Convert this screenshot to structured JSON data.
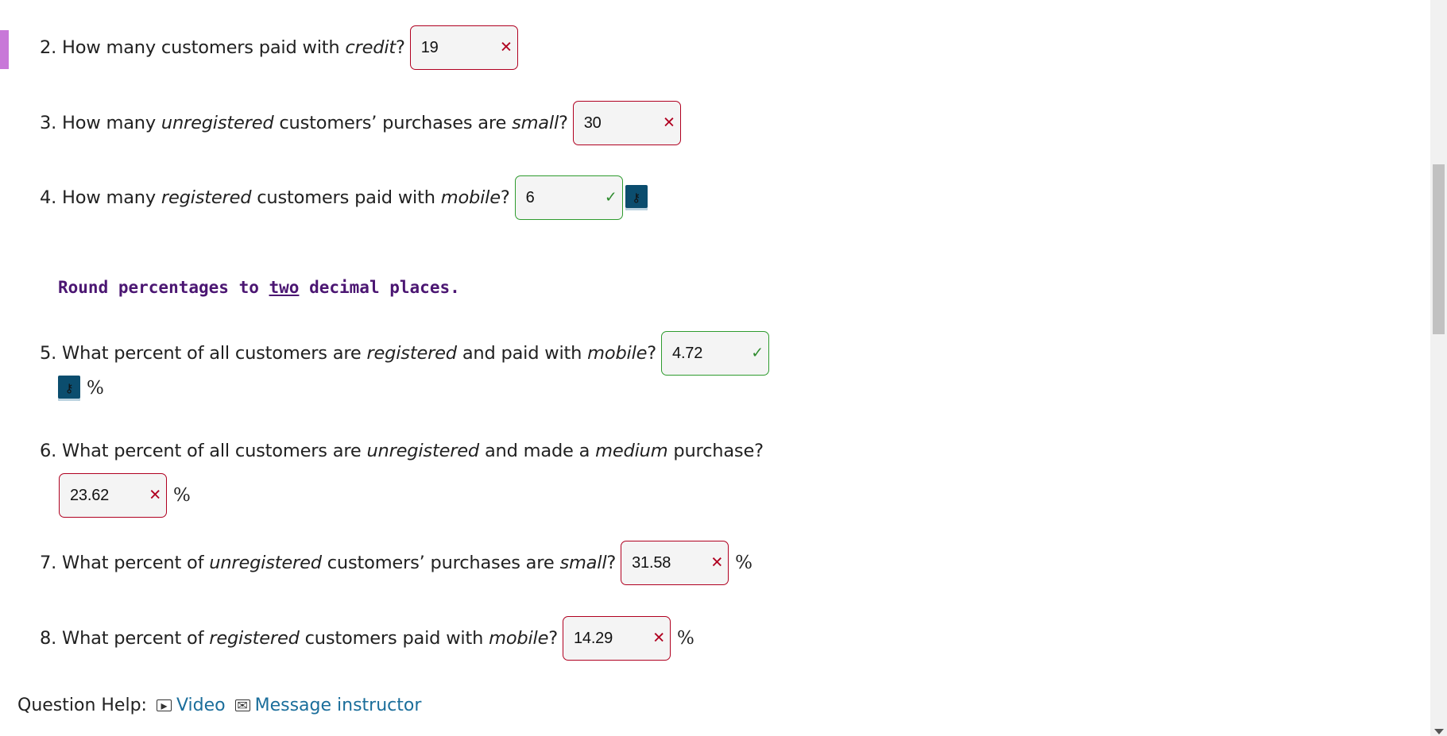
{
  "questions": [
    {
      "num": "2.",
      "parts": [
        {
          "t": "How many customers paid with "
        },
        {
          "t": "credit",
          "i": true
        },
        {
          "t": "?"
        }
      ],
      "answer": "19",
      "status": "wrong",
      "key": false,
      "pct": ""
    },
    {
      "num": "3.",
      "parts": [
        {
          "t": "How many "
        },
        {
          "t": "unregistered",
          "i": true
        },
        {
          "t": " customers’ purchases are "
        },
        {
          "t": "small",
          "i": true
        },
        {
          "t": "?"
        }
      ],
      "answer": "30",
      "status": "wrong",
      "key": false,
      "pct": ""
    },
    {
      "num": "4.",
      "parts": [
        {
          "t": "How many "
        },
        {
          "t": "registered",
          "i": true
        },
        {
          "t": " customers paid with "
        },
        {
          "t": "mobile",
          "i": true
        },
        {
          "t": "?"
        }
      ],
      "answer": "6",
      "status": "right",
      "key": true,
      "pct": ""
    },
    {
      "num": "5.",
      "parts": [
        {
          "t": "What percent of all customers are "
        },
        {
          "t": "registered",
          "i": true
        },
        {
          "t": " and paid with "
        },
        {
          "t": "mobile",
          "i": true
        },
        {
          "t": "?"
        }
      ],
      "answer": "4.72",
      "status": "right",
      "key": true,
      "pct": "%"
    },
    {
      "num": "6.",
      "parts": [
        {
          "t": "What percent of all customers are "
        },
        {
          "t": "unregistered",
          "i": true
        },
        {
          "t": " and made a "
        },
        {
          "t": "medium",
          "i": true
        },
        {
          "t": " purchase?"
        }
      ],
      "answer": "23.62",
      "status": "wrong",
      "key": false,
      "pct": "%"
    },
    {
      "num": "7.",
      "parts": [
        {
          "t": "What percent of "
        },
        {
          "t": "unregistered",
          "i": true
        },
        {
          "t": " customers’ purchases are "
        },
        {
          "t": "small",
          "i": true
        },
        {
          "t": "?"
        }
      ],
      "answer": "31.58",
      "status": "wrong",
      "key": false,
      "pct": "%"
    },
    {
      "num": "8.",
      "parts": [
        {
          "t": "What percent of "
        },
        {
          "t": "registered",
          "i": true
        },
        {
          "t": " customers paid with "
        },
        {
          "t": "mobile",
          "i": true
        },
        {
          "t": "?"
        }
      ],
      "answer": "14.29",
      "status": "wrong",
      "key": false,
      "pct": "%"
    }
  ],
  "note": {
    "before": "Round percentages to ",
    "emph": "two",
    "after": " decimal places."
  },
  "help": {
    "label": "Question Help:",
    "video": "Video",
    "message": "Message instructor"
  },
  "marks": {
    "wrong": "✕",
    "right": "✓",
    "key": "⚷"
  },
  "colors": {
    "wrong_border": "#b00020",
    "right_border": "#2e9b2e",
    "key_bg": "#0b4d6e",
    "note_color": "#4b1672",
    "link": "#1b6e9b",
    "accent": "#c878d8"
  }
}
